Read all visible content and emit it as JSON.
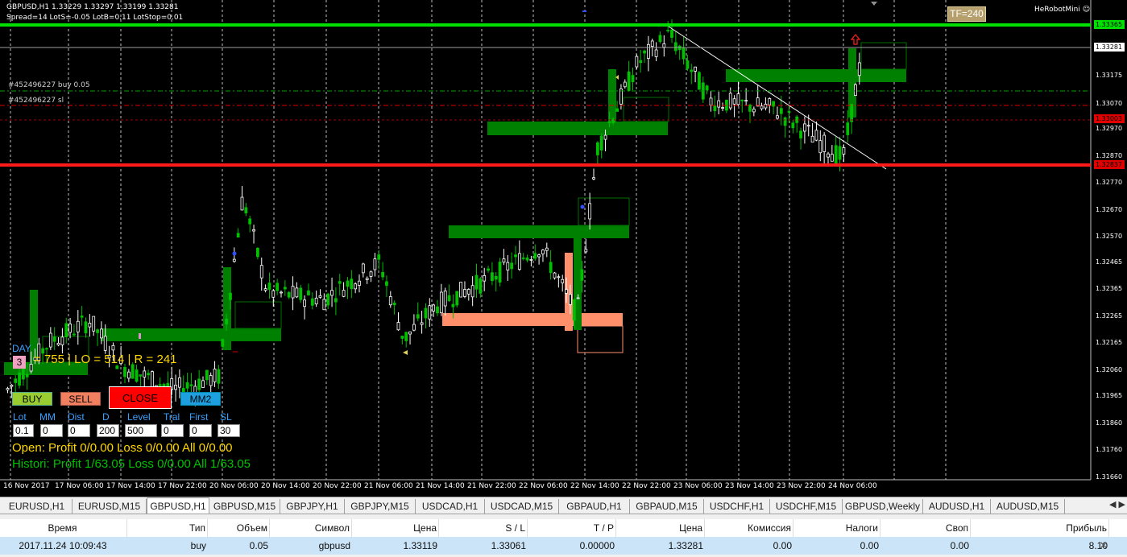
{
  "chart": {
    "header_line1": "GBPUSD,H1  1.33229 1.33297 1.33199 1.33281",
    "header_line2": "Spread=14  LotS=-0.05  LotB=0.11  LotStop=0.01",
    "order_buy_label": "#452496227 buy 0.05",
    "order_sl_label": "#452496227 sl",
    "tf_badge": "TF=240",
    "robot_label": "HeRobotMini",
    "day_label": "DAY",
    "day_counter": "3",
    "stats_line": "= 755 | LO = 514 | R = 241",
    "price_levels": [
      "1.33365",
      "1.33281",
      "1.33175",
      "1.33070",
      "1.33003",
      "1.32970",
      "1.32870",
      "1.32837",
      "1.32770",
      "1.32670",
      "1.32570",
      "1.32465",
      "1.32365",
      "1.32265",
      "1.32165",
      "1.32060",
      "1.31965",
      "1.31860",
      "1.31760",
      "1.31660"
    ],
    "time_labels": [
      "16 Nov 2017",
      "17 Nov 06:00",
      "17 Nov 14:00",
      "17 Nov 22:00",
      "20 Nov 06:00",
      "20 Nov 14:00",
      "20 Nov 22:00",
      "21 Nov 06:00",
      "21 Nov 14:00",
      "21 Nov 22:00",
      "22 Nov 06:00",
      "22 Nov 14:00",
      "22 Nov 22:00",
      "23 Nov 06:00",
      "23 Nov 14:00",
      "23 Nov 22:00",
      "24 Nov 06:00"
    ],
    "colors": {
      "bull": "#ffffff",
      "bear": "#00c000",
      "resist": "#00e000",
      "support": "#ff1a1a",
      "zone": "#008000",
      "sell_zone": "#ff8f6b"
    }
  },
  "panel": {
    "buy_label": "BUY",
    "sell_label": "SELL",
    "close_label": "CLOSE",
    "mm2_label": "MM2",
    "param_labels": [
      "Lot",
      "MM",
      "Dist",
      "D",
      "Level",
      "Tral",
      "First",
      "SL"
    ],
    "param_values": [
      "0.1",
      "0",
      "0",
      "200",
      "500",
      "0",
      "0",
      "30"
    ],
    "open_line": "Open:  Profit 0/0.00  Loss 0/0.00  All 0/0.00",
    "histori_line": "Histori:  Profit 1/63.05  Loss 0/0.00  All 1/63.05"
  },
  "tabs": [
    "EURUSD,H1",
    "EURUSD,M15",
    "GBPUSD,H1",
    "GBPUSD,M15",
    "GBPJPY,H1",
    "GBPJPY,M15",
    "USDCAD,H1",
    "USDCAD,M15",
    "GBPAUD,H1",
    "GBPAUD,M15",
    "USDCHF,H1",
    "USDCHF,M15",
    "GBPUSD,Weekly",
    "AUDUSD,H1",
    "AUDUSD,M15"
  ],
  "active_tab": "GBPUSD,H1",
  "table": {
    "headers": [
      "Время",
      "Тип",
      "Объем",
      "Символ",
      "Цена",
      "S / L",
      "T / P",
      "Цена",
      "Комиссия",
      "Налоги",
      "Своп",
      "Прибыль"
    ],
    "row": [
      "2017.11.24 10:09:43",
      "buy",
      "0.05",
      "gbpusd",
      "1.33119",
      "1.33061",
      "0.00000",
      "1.33281",
      "0.00",
      "0.00",
      "0.00",
      "8.10"
    ],
    "close_icon": "close-icon"
  }
}
